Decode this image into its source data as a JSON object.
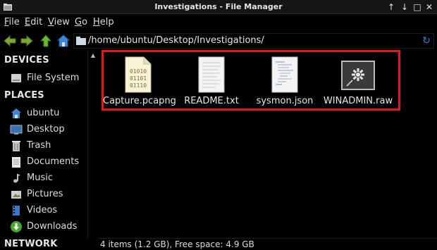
{
  "window": {
    "title": "Investigations - File Manager"
  },
  "menu": [
    {
      "label": "File",
      "accel": "F",
      "rest": "ile"
    },
    {
      "label": "Edit",
      "accel": "E",
      "rest": "dit"
    },
    {
      "label": "View",
      "accel": "V",
      "rest": "iew"
    },
    {
      "label": "Go",
      "accel": "G",
      "rest": "o"
    },
    {
      "label": "Help",
      "accel": "H",
      "rest": "elp"
    }
  ],
  "toolbar": {
    "path": "/home/ubuntu/Desktop/Investigations/"
  },
  "sidebar": {
    "devices_header": "DEVICES",
    "devices": [
      {
        "label": "File System",
        "icon": "drive-icon"
      }
    ],
    "places_header": "PLACES",
    "places": [
      {
        "label": "ubuntu",
        "icon": "home-icon"
      },
      {
        "label": "Desktop",
        "icon": "desktop-icon"
      },
      {
        "label": "Trash",
        "icon": "trash-icon"
      },
      {
        "label": "Documents",
        "icon": "documents-icon"
      },
      {
        "label": "Music",
        "icon": "music-icon"
      },
      {
        "label": "Pictures",
        "icon": "pictures-icon"
      },
      {
        "label": "Videos",
        "icon": "videos-icon"
      },
      {
        "label": "Downloads",
        "icon": "downloads-icon"
      }
    ],
    "network_header": "NETWORK"
  },
  "files": [
    {
      "name": "Capture.pcapng",
      "icon": "binary-file-icon"
    },
    {
      "name": "README.txt",
      "icon": "text-file-icon"
    },
    {
      "name": "sysmon.json",
      "icon": "json-file-icon"
    },
    {
      "name": "WINADMIN.raw",
      "icon": "raw-file-icon"
    }
  ],
  "status": {
    "text": "4 items (1.2 GB), Free space: 4.9 GB"
  },
  "colors": {
    "highlight": "#e8141b",
    "accent": "#2d7fe0",
    "background": "#000000"
  }
}
